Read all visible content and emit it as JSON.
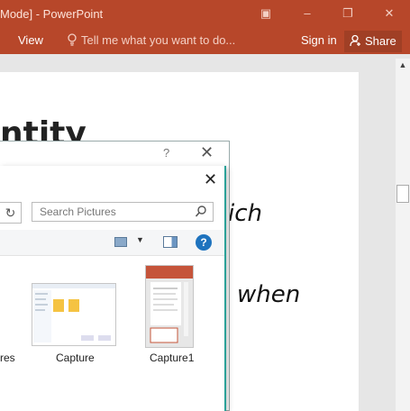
{
  "window": {
    "title": "Mode] - PowerPoint",
    "controls": [
      "▣",
      "–",
      "❐",
      "✕"
    ]
  },
  "ribbon": {
    "view_tab": "View",
    "tell_me": "Tell me what you want to do...",
    "sign_in": "Sign in",
    "share": "Share"
  },
  "slide": {
    "title_fragment": "ntity",
    "line1_fragment": "ich",
    "line2_fragment": "when"
  },
  "outer_dialog": {
    "help": "?",
    "close": "✕"
  },
  "file_dialog": {
    "close": "✕",
    "refresh_icon": "↻",
    "search_placeholder": "Search Pictures",
    "help": "?",
    "files": [
      {
        "label": "res"
      },
      {
        "label": "Capture"
      },
      {
        "label": "Capture1"
      }
    ]
  }
}
